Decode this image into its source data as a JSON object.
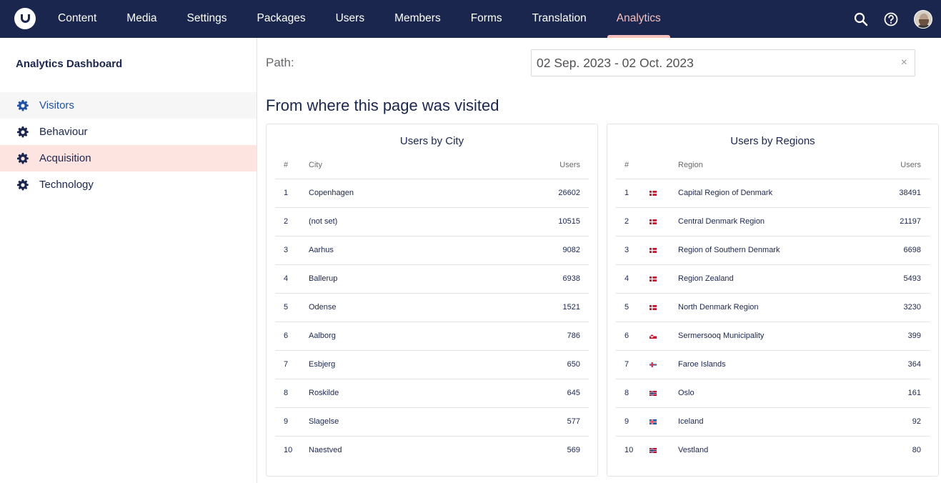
{
  "nav": {
    "items": [
      {
        "label": "Content"
      },
      {
        "label": "Media"
      },
      {
        "label": "Settings"
      },
      {
        "label": "Packages"
      },
      {
        "label": "Users"
      },
      {
        "label": "Members"
      },
      {
        "label": "Forms"
      },
      {
        "label": "Translation"
      },
      {
        "label": "Analytics"
      }
    ],
    "active": "Analytics",
    "icons": [
      "search-icon",
      "help-icon",
      "user-avatar"
    ]
  },
  "sidebar": {
    "title": "Analytics Dashboard",
    "items": [
      {
        "label": "Visitors",
        "icon": "gear-icon"
      },
      {
        "label": "Behaviour",
        "icon": "gear-icon"
      },
      {
        "label": "Acquisition",
        "icon": "gear-icon"
      },
      {
        "label": "Technology",
        "icon": "gear-icon"
      }
    ],
    "active": "Acquisition"
  },
  "main": {
    "path_label": "Path:",
    "date_range": "02 Sep. 2023 - 02 Oct. 2023",
    "clear_symbol": "×",
    "section_title": "From where this page was visited"
  },
  "city_card": {
    "title": "Users by City",
    "headers": {
      "num": "#",
      "name": "City",
      "users": "Users"
    },
    "rows": [
      {
        "num": "1",
        "name": "Copenhagen",
        "users": "26602"
      },
      {
        "num": "2",
        "name": "(not set)",
        "users": "10515"
      },
      {
        "num": "3",
        "name": "Aarhus",
        "users": "9082"
      },
      {
        "num": "4",
        "name": "Ballerup",
        "users": "6938"
      },
      {
        "num": "5",
        "name": "Odense",
        "users": "1521"
      },
      {
        "num": "6",
        "name": "Aalborg",
        "users": "786"
      },
      {
        "num": "7",
        "name": "Esbjerg",
        "users": "650"
      },
      {
        "num": "8",
        "name": "Roskilde",
        "users": "645"
      },
      {
        "num": "9",
        "name": "Slagelse",
        "users": "577"
      },
      {
        "num": "10",
        "name": "Naestved",
        "users": "569"
      }
    ]
  },
  "region_card": {
    "title": "Users by Regions",
    "headers": {
      "num": "#",
      "name": "Region",
      "users": "Users"
    },
    "rows": [
      {
        "num": "1",
        "flag": "denmark-flag-icon",
        "name": "Capital Region of Denmark",
        "users": "38491"
      },
      {
        "num": "2",
        "flag": "denmark-flag-icon",
        "name": "Central Denmark Region",
        "users": "21197"
      },
      {
        "num": "3",
        "flag": "denmark-flag-icon",
        "name": "Region of Southern Denmark",
        "users": "6698"
      },
      {
        "num": "4",
        "flag": "denmark-flag-icon",
        "name": "Region Zealand",
        "users": "5493"
      },
      {
        "num": "5",
        "flag": "denmark-flag-icon",
        "name": "North Denmark Region",
        "users": "3230"
      },
      {
        "num": "6",
        "flag": "greenland-flag-icon",
        "name": "Sermersooq Municipality",
        "users": "399"
      },
      {
        "num": "7",
        "flag": "faroe-islands-flag-icon",
        "name": "Faroe Islands",
        "users": "364"
      },
      {
        "num": "8",
        "flag": "norway-flag-icon",
        "name": "Oslo",
        "users": "161"
      },
      {
        "num": "9",
        "flag": "iceland-flag-icon",
        "name": "Iceland",
        "users": "92"
      },
      {
        "num": "10",
        "flag": "norway-flag-icon",
        "name": "Vestland",
        "users": "80"
      }
    ]
  },
  "colors": {
    "header_bg": "#1b264f",
    "active_accent": "#f5c1bc",
    "active_sidebar_bg": "#fde4e1",
    "text_primary": "#1b264f"
  }
}
